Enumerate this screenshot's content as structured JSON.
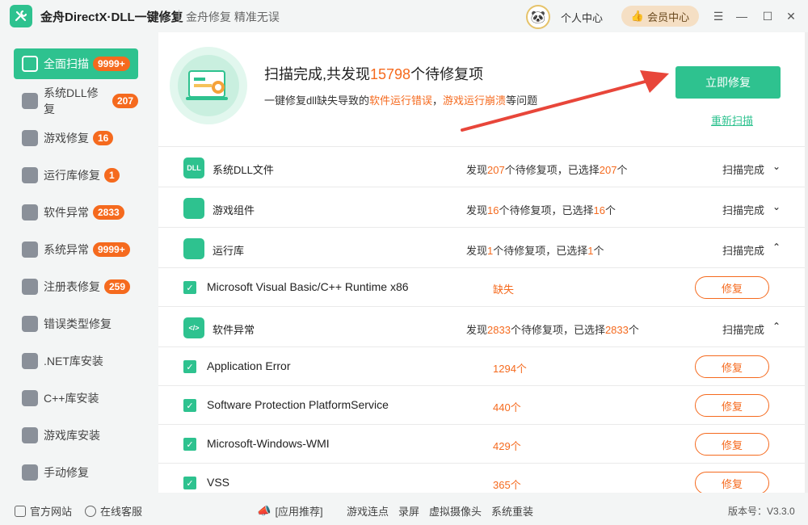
{
  "app": {
    "title": "金舟DirectX·DLL一键修复",
    "slogan": "金舟修复 精准无误"
  },
  "header": {
    "personal_label": "个人中心",
    "vip_label": "会员中心"
  },
  "sidebar": {
    "items": [
      {
        "label": "全面扫描",
        "badge": "9999+",
        "icon": "scan-icon",
        "active": true
      },
      {
        "label": "系统DLL修复",
        "badge": "207",
        "icon": "dll-icon"
      },
      {
        "label": "游戏修复",
        "badge": "16",
        "icon": "gamepad-icon"
      },
      {
        "label": "运行库修复",
        "badge": "1",
        "icon": "runtime-icon"
      },
      {
        "label": "软件异常",
        "badge": "2833",
        "icon": "code-icon"
      },
      {
        "label": "系统异常",
        "badge": "9999+",
        "icon": "gear-icon"
      },
      {
        "label": "注册表修复",
        "badge": "259",
        "icon": "registry-icon"
      },
      {
        "label": "错误类型修复",
        "badge": "",
        "icon": "warning-icon"
      },
      {
        "label": ".NET库安装",
        "badge": "",
        "icon": "dotnet-icon"
      },
      {
        "label": "C++库安装",
        "badge": "",
        "icon": "cpp-icon"
      },
      {
        "label": "游戏库安装",
        "badge": "",
        "icon": "game-library-icon"
      },
      {
        "label": "手动修复",
        "badge": "",
        "icon": "wrench-icon"
      }
    ]
  },
  "hero": {
    "title_prefix": "扫描完成,共发现",
    "title_count": "15798",
    "title_suffix": "个待修复项",
    "sub_prefix": "一键修复dll缺失导致的",
    "sub_hl1": "软件运行错误",
    "sub_mid": "，",
    "sub_hl2": "游戏运行崩溃",
    "sub_suffix": "等问题",
    "fix_now_label": "立即修复",
    "rescan_label": "重新扫描"
  },
  "categories": [
    {
      "name": "系统DLL文件",
      "icon": "dll-icon",
      "icon_text": "DLL",
      "found_prefix": "发现",
      "found": "207",
      "found_mid": "个待修复项，已选择",
      "selected": "207",
      "found_suffix": "个",
      "status": "扫描完成",
      "chevron": "⌄"
    },
    {
      "name": "游戏组件",
      "icon": "gamepad-icon",
      "icon_text": "",
      "found_prefix": "发现",
      "found": "16",
      "found_mid": "个待修复项，已选择",
      "selected": "16",
      "found_suffix": "个",
      "status": "扫描完成",
      "chevron": "⌄"
    },
    {
      "name": "运行库",
      "icon": "runtime-icon",
      "icon_text": "",
      "found_prefix": "发现",
      "found": "1",
      "found_mid": "个待修复项，已选择",
      "selected": "1",
      "found_suffix": "个",
      "status": "扫描完成",
      "chevron": "⌃"
    },
    {
      "name": "软件异常",
      "icon": "code-icon",
      "icon_text": "</>",
      "found_prefix": "发现",
      "found": "2833",
      "found_mid": "个待修复项，已选择",
      "selected": "2833",
      "found_suffix": "个",
      "status": "扫描完成",
      "chevron": "⌃"
    }
  ],
  "items": [
    {
      "name": "Microsoft Visual Basic/C++ Runtime x86",
      "value": "缺失",
      "repair_label": "修复"
    },
    {
      "name": "Application Error",
      "value": "1294个",
      "repair_label": "修复"
    },
    {
      "name": "Software Protection PlatformService",
      "value": "440个",
      "repair_label": "修复"
    },
    {
      "name": "Microsoft-Windows-WMI",
      "value": "429个",
      "repair_label": "修复"
    },
    {
      "name": "VSS",
      "value": "365个",
      "repair_label": "修复"
    }
  ],
  "footer": {
    "website_label": "官方网站",
    "support_label": "在线客服",
    "recommend_label": "[应用推荐]",
    "links": [
      "游戏连点",
      "录屏",
      "虚拟摄像头",
      "系统重装"
    ],
    "version_label": "版本号：V3.3.0"
  },
  "colors": {
    "accent": "#2ec28f",
    "highlight": "#f56a1e",
    "badge": "#f56a1e"
  }
}
